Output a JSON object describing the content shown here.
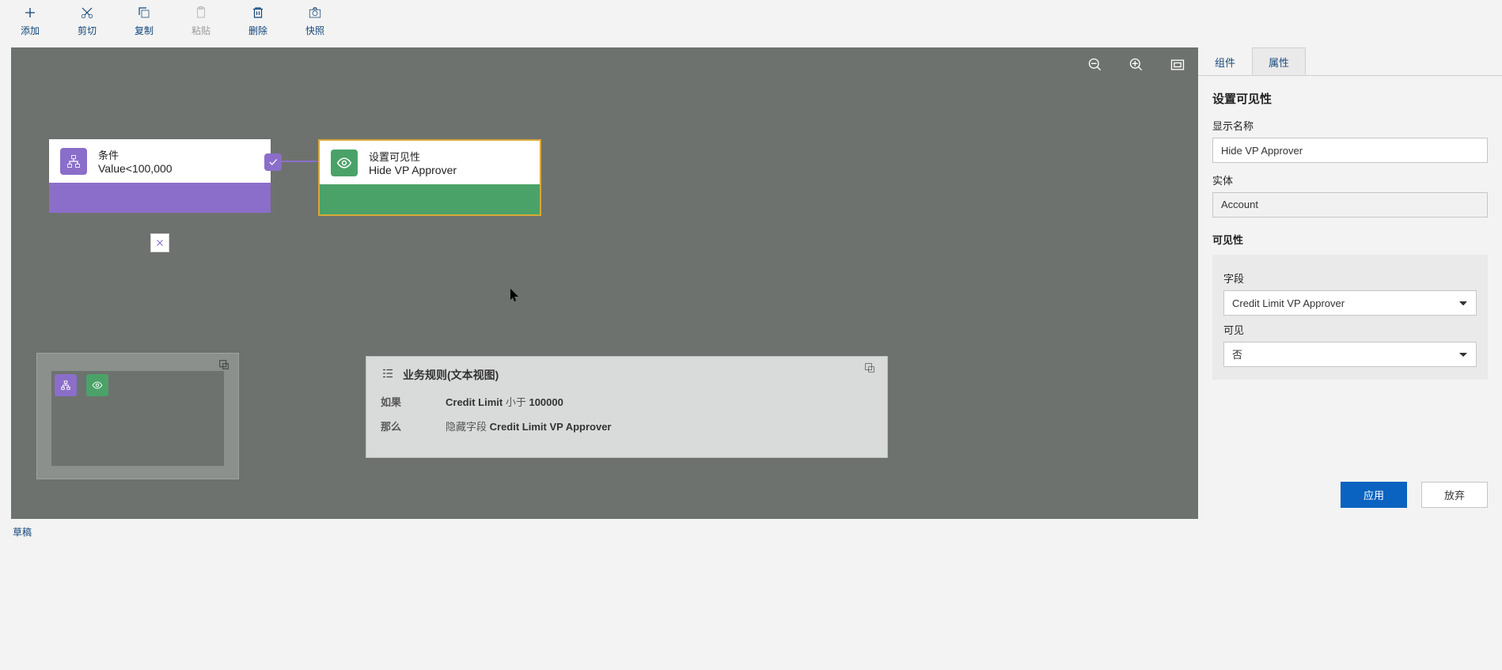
{
  "toolbar": {
    "add": "添加",
    "cut": "剪切",
    "copy": "复制",
    "paste": "粘贴",
    "delete": "删除",
    "snapshot": "快照"
  },
  "canvas": {
    "condition_title": "条件",
    "condition_expr": "Value<100,000",
    "action_title": "设置可见性",
    "action_subtitle": "Hide VP Approver"
  },
  "textview": {
    "header": "业务规则(文本视图)",
    "if_label": "如果",
    "if_value_pre": "Credit Limit ",
    "if_value_mid": "小于 ",
    "if_value_bold": "100000",
    "then_label": "那么",
    "then_value_pre": "隐藏字段 ",
    "then_value_bold": "Credit Limit VP Approver"
  },
  "panel": {
    "tab_components": "组件",
    "tab_properties": "属性",
    "section_title": "设置可见性",
    "display_name_label": "显示名称",
    "display_name_value": "Hide VP Approver",
    "entity_label": "实体",
    "entity_value": "Account",
    "visibility_label": "可见性",
    "field_label": "字段",
    "field_value": "Credit Limit VP Approver",
    "visible_label": "可见",
    "visible_value": "否",
    "apply": "应用",
    "discard": "放弃"
  },
  "status": {
    "draft": "草稿"
  }
}
